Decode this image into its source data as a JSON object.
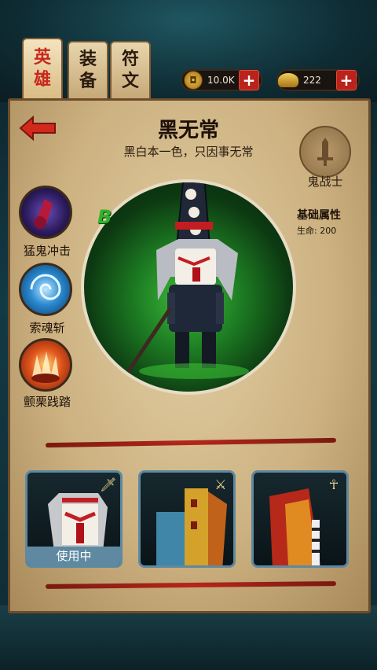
{
  "tabs": [
    {
      "label": "英雄",
      "active": true
    },
    {
      "label": "装备",
      "active": false
    },
    {
      "label": "符文",
      "active": false
    }
  ],
  "currency": {
    "coins": "10.0K",
    "ingots": "222",
    "plus": "+"
  },
  "hero": {
    "name": "黑无常",
    "tagline": "黑白本一色，只因事无常",
    "grade": "B",
    "class_label": "鬼战士",
    "attributes_title": "基础属性",
    "hp_line": "生命: 200"
  },
  "skills": [
    {
      "label": "猛鬼冲击",
      "icon": "claw-strike-icon"
    },
    {
      "label": "索魂斩",
      "icon": "vortex-icon"
    },
    {
      "label": "颤栗践踏",
      "icon": "fire-stomp-icon"
    }
  ],
  "skins": [
    {
      "icon": "sword-icon",
      "badge": "使用中",
      "in_use": true
    },
    {
      "icon": "locked-axe-icon",
      "badge": "",
      "in_use": false
    },
    {
      "icon": "staff-icon",
      "badge": "",
      "in_use": false
    }
  ],
  "colors": {
    "accent_red": "#c8271b",
    "parchment": "#cdb282",
    "card_border": "#5e89a0",
    "grade_green": "#2fb32a"
  }
}
